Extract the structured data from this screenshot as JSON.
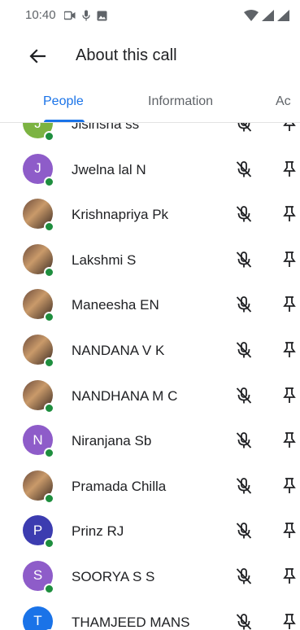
{
  "status_bar": {
    "time": "10:40",
    "icons_left": [
      "video-icon",
      "mic-status-icon",
      "image-icon"
    ],
    "icons_right": [
      "wifi-icon",
      "signal-icon",
      "signal-icon-2"
    ]
  },
  "app_bar": {
    "title": "About this call",
    "back_icon": "arrow-back-icon"
  },
  "tabs": [
    {
      "label": "People",
      "selected": true
    },
    {
      "label": "Information",
      "selected": false
    },
    {
      "label": "Ac",
      "selected": false
    }
  ],
  "colors": {
    "accent": "#1a73e8",
    "presence": "#1e8e3e",
    "avatar_purple": "#8e5cc9",
    "avatar_indigo": "#3c3cb0",
    "avatar_blue": "#1a73e8"
  },
  "participants": [
    {
      "name": "Jisinsha ss",
      "initial": "J",
      "avatar_color": "#7cb342",
      "photo": false
    },
    {
      "name": "Jwelna lal N",
      "initial": "J",
      "avatar_color": "#8e5cc9",
      "photo": false
    },
    {
      "name": "Krishnapriya Pk",
      "initial": "",
      "avatar_color": "",
      "photo": true
    },
    {
      "name": "Lakshmi S",
      "initial": "",
      "avatar_color": "",
      "photo": true
    },
    {
      "name": "Maneesha EN",
      "initial": "",
      "avatar_color": "",
      "photo": true
    },
    {
      "name": "NANDANA V K",
      "initial": "",
      "avatar_color": "",
      "photo": true
    },
    {
      "name": "NANDHANA M C",
      "initial": "",
      "avatar_color": "",
      "photo": true
    },
    {
      "name": "Niranjana Sb",
      "initial": "N",
      "avatar_color": "#8e5cc9",
      "photo": false
    },
    {
      "name": "Pramada Chilla",
      "initial": "",
      "avatar_color": "",
      "photo": true
    },
    {
      "name": "Prinz RJ",
      "initial": "P",
      "avatar_color": "#3c3cb0",
      "photo": false
    },
    {
      "name": "SOORYA S S",
      "initial": "S",
      "avatar_color": "#8e5cc9",
      "photo": false
    },
    {
      "name": "THAMJEED MANS",
      "initial": "T",
      "avatar_color": "#1a73e8",
      "photo": false
    }
  ]
}
